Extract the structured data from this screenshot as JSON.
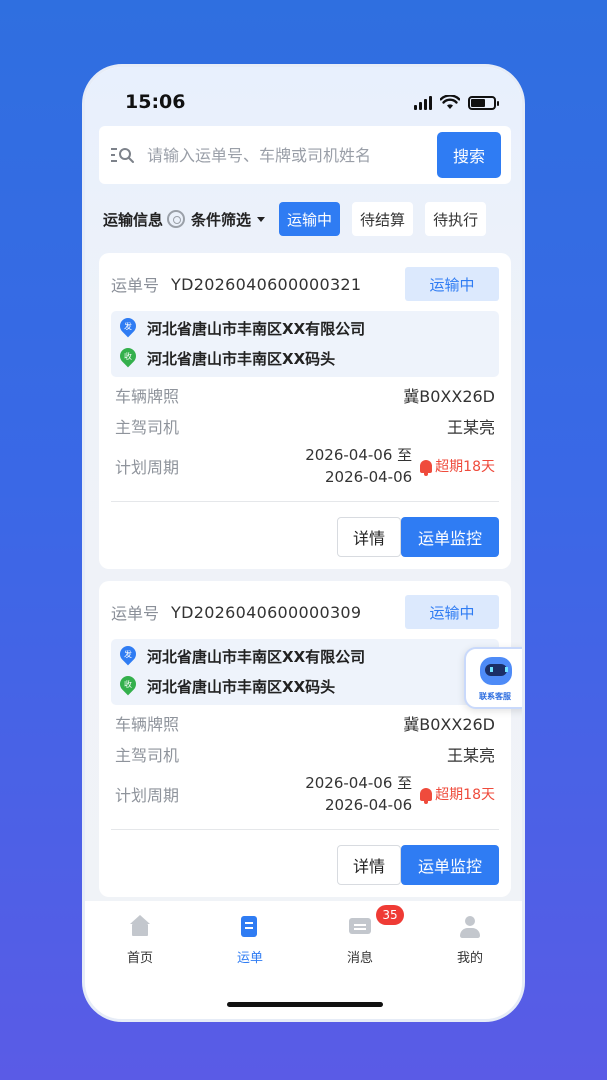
{
  "status_bar": {
    "time": "15:06"
  },
  "search": {
    "placeholder": "请输入运单号、车牌或司机姓名",
    "button": "搜索"
  },
  "filters": {
    "transport_info": "运输信息",
    "condition": "条件筛选",
    "chips": [
      "运输中",
      "待结算",
      "待执行"
    ]
  },
  "cards": [
    {
      "waybill_label": "运单号",
      "waybill_no": "YD2026040600000321",
      "status": "运输中",
      "from_tag": "发",
      "from": "河北省唐山市丰南区XX有限公司",
      "to_tag": "收",
      "to": "河北省唐山市丰南区XX码头",
      "plate_label": "车辆牌照",
      "plate": "冀B0XX26D",
      "driver_label": "主驾司机",
      "driver": "王某亮",
      "period_label": "计划周期",
      "period_start": "2026-04-06 至",
      "period_end": "2026-04-06",
      "overdue": "超期18天",
      "detail_btn": "详情",
      "monitor_btn": "运单监控"
    },
    {
      "waybill_label": "运单号",
      "waybill_no": "YD2026040600000309",
      "status": "运输中",
      "from_tag": "发",
      "from": "河北省唐山市丰南区XX有限公司",
      "to_tag": "收",
      "to": "河北省唐山市丰南区XX码头",
      "plate_label": "车辆牌照",
      "plate": "冀B0XX26D",
      "driver_label": "主驾司机",
      "driver": "王某亮",
      "period_label": "计划周期",
      "period_start": "2026-04-06 至",
      "period_end": "2026-04-06",
      "overdue": "超期18天",
      "detail_btn": "详情",
      "monitor_btn": "运单监控"
    }
  ],
  "customer_service": {
    "label": "联系客服"
  },
  "tabbar": {
    "items": [
      {
        "label": "首页",
        "icon": "home-icon"
      },
      {
        "label": "运单",
        "icon": "waybill-icon"
      },
      {
        "label": "消息",
        "icon": "message-icon",
        "badge": "35"
      },
      {
        "label": "我的",
        "icon": "user-icon"
      }
    ]
  },
  "colors": {
    "primary": "#2f7cf3",
    "danger": "#ef4b3c",
    "receive": "#34b04c"
  }
}
